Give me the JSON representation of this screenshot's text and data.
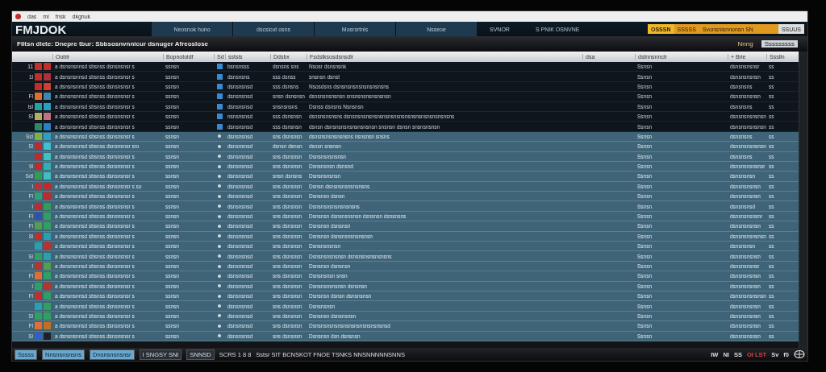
{
  "titlebar": {
    "menu": [
      "das",
      "mi",
      "fnsk",
      "dkgnuk"
    ]
  },
  "header": {
    "logo": "FMJDOK",
    "tabs": [
      {
        "label": "Neosnok huno",
        "selected": false
      },
      {
        "label": "dscsicut osns",
        "selected": false
      },
      {
        "label": "Mosrsrtnis",
        "selected": false
      },
      {
        "label": "Nsseoe",
        "selected": false
      }
    ],
    "items": [
      "SVNOR",
      "S PNIK OSNVNE"
    ],
    "alert": [
      "OSSSN",
      "SSSSS",
      "Svonsnisnnonsn SN",
      "SSUUS"
    ]
  },
  "filterbar": {
    "text": "Filtsn dlete: Dnepre tbur: Sbbsosnvnnicur dsnuger Afreoslose",
    "label": "Nnng",
    "value": "Sssssssss"
  },
  "table": {
    "columns": [
      "Ooblr",
      "Bopnotoldf",
      "Sd",
      "sstsis",
      "Ddsbx",
      "Fsdstksosdsnsdlr",
      "dsa",
      "dstnnsnnclr",
      "+ Brie",
      "Ssslln"
    ],
    "rows": [
      {
        "marker": "11",
        "tags": [
          {
            "color": "#c0302a"
          },
          {
            "color": "#c0302a"
          }
        ],
        "cells": [
          "a dsnsnsnnsd sbsnss dsnsnsnsr s",
          "ssnsn",
          "",
          "bsnsnsss",
          "dsnsns sns",
          "Nsosr dsnsnsnk",
          "",
          "Ssnsn",
          "dsnsnsnsnsr",
          "ss"
        ],
        "selected": false
      },
      {
        "marker": "1l",
        "tags": [
          {
            "color": "#c0302a"
          },
          {
            "color": "#b0303a"
          }
        ],
        "cells": [
          "a dsnsnsnnsd sbsnss dsnsnsnsr s",
          "ssnsn",
          "",
          "dsnsnsns",
          "sss dsnss",
          "snsnsn dsnst",
          "",
          "Ssnsn",
          "dsnsnsnsnsn",
          "ss"
        ],
        "selected": false
      },
      {
        "marker": "",
        "tags": [
          {
            "color": "#c0302a"
          },
          {
            "color": "#d04030"
          }
        ],
        "cells": [
          "a dsnsnsnnsd sbsnss dsnsnsnsr s",
          "ssnsn",
          "",
          "dsnsnsnsd",
          "sss dsnsns",
          "Nsosdsns dsnsnsnsnsnsnsnsnsns",
          "",
          "Ssnsn",
          "dsnsnsns",
          "ss"
        ],
        "selected": false
      },
      {
        "marker": "Fl",
        "tags": [
          {
            "color": "#e07030"
          },
          {
            "color": "#3a8ab0"
          }
        ],
        "cells": [
          "a dsnsnsnnsd sbsnss dsnsnsnsr s",
          "ssnsn",
          "",
          "dsnsnsnsd",
          "snsn dsnsnsn",
          "dsnsnsnsnsnsn snsnsnsnsnsnsnsn",
          "",
          "Ssnsn",
          "dsnsnsnsnsn",
          "ss"
        ],
        "selected": false
      },
      {
        "marker": "lsl",
        "tags": [
          {
            "color": "#2aa0a0"
          },
          {
            "color": "#2a9fc0"
          }
        ],
        "cells": [
          "a dsnsnsnnsd sbsnss dsnsnsnsr s",
          "ssnsn",
          "",
          "dsnsnsnsd",
          "snsnsnsns",
          "Dsnss dsnsns Nsnsnsn",
          "",
          "Ssnsn",
          "dsnsnsns",
          "ss"
        ],
        "selected": false
      },
      {
        "marker": "Sl",
        "tags": [
          {
            "color": "#b0b060"
          },
          {
            "color": "#c07080"
          }
        ],
        "cells": [
          "a dsnsnsnnsd sbsnss dsnsnsnsr s",
          "ssnsn",
          "",
          "nsnsnsnsd",
          "sss dsnsnsn",
          "dsnsnsnsnsns dsnsnsnsnsnsnsnsnsnsnsnsnsnsnsnsnsnsnsns",
          "",
          "Ssnsn",
          "dsnsnsnsnsnsn",
          "ss"
        ],
        "selected": false
      },
      {
        "marker": "",
        "tags": [
          {
            "color": "#2a8a6a"
          },
          {
            "color": "#2a80c0"
          }
        ],
        "cells": [
          "a dsnsnsnnsd sbsnss dsnsnsnsr s",
          "ssnsn",
          "",
          "dsnsnsnsd",
          "sss dsnsnsn",
          "dsnsn dsnsnsnsnsnsnsnsnsn snsnsn dsnsn snsnsnsnsn",
          "",
          "Ssnsn",
          "dsnsnsnsnsnsn",
          "ss"
        ],
        "selected": false
      },
      {
        "marker": "Ssl",
        "tags": [
          {
            "color": "#80b040"
          },
          {
            "color": "#30a0c0"
          }
        ],
        "cells": [
          "a dsnsnsnnsd sbsnss dsnsnsnsr s",
          "ssnsn",
          "",
          "dsnsnsnsd",
          "sns dsnsnsn",
          "dsnsnsnsnsnsnsns nsnsnsn snsns",
          "",
          "Ssnsn",
          "dsnsnsns",
          "ss"
        ],
        "selected": true
      },
      {
        "marker": "Sl",
        "tags": [
          {
            "color": "#c02a2a"
          },
          {
            "color": "#40c0d0"
          }
        ],
        "cells": [
          "a dsnsnsnnsd sbsnss dsnsnsnsr sro",
          "ssnsn",
          "",
          "dsnsnsnsd",
          "dsnsn dsnsn",
          "dsnsn snsnsn",
          "",
          "Ssnsn",
          "dsnsnsnsnsnsn",
          "ss"
        ],
        "selected": true
      },
      {
        "marker": "",
        "tags": [
          {
            "color": "#c02a2a"
          },
          {
            "color": "#40c0c0"
          }
        ],
        "cells": [
          "a dsnsnsnnsd sbsnss dsnsnsnsr s",
          "ssnsn",
          "",
          "dsnsnsnsd",
          "sns dsnsnsn",
          "Dsnsnsnsnsnsn",
          "",
          "Ssnsn",
          "dsnsnsns",
          "ss"
        ],
        "selected": true
      },
      {
        "marker": "9l",
        "tags": [
          {
            "color": "#c02a2a"
          },
          {
            "color": "#30b0b0"
          }
        ],
        "cells": [
          "a dsnsnsnnsd sbsnss dsnsnsnsr s",
          "ssnsn",
          "",
          "dsnsnsnsd",
          "sns dsnsnsn",
          "Dsnsnsnsn dsnsnd",
          "",
          "Ssnsn",
          "dsnsnsnsnsnsr",
          "ss"
        ],
        "selected": true
      },
      {
        "marker": "Sdl",
        "tags": [
          {
            "color": "#30a050"
          },
          {
            "color": "#40c0c0"
          }
        ],
        "cells": [
          "a dsnsnsnnsd sbsnss dsnsnsnsr s",
          "ssnsn",
          "",
          "dsnsnsnsd",
          "snsn dsnsns",
          "Dsnsnsnsnsn",
          "",
          "Ssnsn",
          "dsnsnsnsn",
          "ss"
        ],
        "selected": true
      },
      {
        "marker": "l",
        "tags": [
          {
            "color": "#c03030"
          },
          {
            "color": "#c02a2a"
          }
        ],
        "cells": [
          "a dsnsnsnnsd sbsnss dsnsnsnsr s so",
          "ssnsn",
          "",
          "dsnsnsnsd",
          "sns dsnsnsn",
          "Dsnsn dsnsnsnsnsnsnsns",
          "",
          "Ssnsn",
          "dsnsnsnsnsn",
          "ss"
        ],
        "selected": true
      },
      {
        "marker": "Fl",
        "tags": [
          {
            "color": "#30a070"
          },
          {
            "color": "#c02a2a"
          }
        ],
        "cells": [
          "a dsnsnsnnsd sbsnss dsnsnsnsr s",
          "ssnsn",
          "",
          "dsnsnsnsd",
          "sns dsnsnsn",
          "Dsnsnsn dsnsn",
          "",
          "Ssnsn",
          "dsnsnsnsnsn",
          "ss"
        ],
        "selected": true
      },
      {
        "marker": "l",
        "tags": [
          {
            "color": "#c02a2a"
          },
          {
            "color": "#30a050"
          }
        ],
        "cells": [
          "a dsnsnsnnsd sbsnss dsnsnsnsr s",
          "ssnsn",
          "",
          "dsnsnsnsd",
          "sns dsnsnsn",
          "Dsnsnsnsnsnsnsnsns",
          "",
          "Ssnsn",
          "dsnsnsnsd",
          "ss"
        ],
        "selected": true
      },
      {
        "marker": "Fl",
        "tags": [
          {
            "color": "#3050b0"
          },
          {
            "color": "#30a060"
          }
        ],
        "cells": [
          "a dsnsnsnnsd sbsnss dsnsnsnsr s",
          "ssnsn",
          "",
          "dsnsnsnsd",
          "sns dsnsnsn",
          "Dsnsnsn dsnsnsnsnsn dsnsnsn dsnsnsns",
          "",
          "Ssnsn",
          "dsnsnsnsnsnr",
          "ss"
        ],
        "selected": true
      },
      {
        "marker": "Fl",
        "tags": [
          {
            "color": "#50a050"
          },
          {
            "color": "#30a060"
          }
        ],
        "cells": [
          "a dsnsnsnnsd sbsnss dsnsnsnsr s",
          "ssnsn",
          "",
          "dsnsnsnsd",
          "sns dsnsnsn",
          "Dsnsnsn dsnsnsn",
          "",
          "Ssnsn",
          "dsnsnsnsnsn",
          "ss"
        ],
        "selected": true
      },
      {
        "marker": "8l",
        "tags": [
          {
            "color": "#c0302a"
          },
          {
            "color": "#2a9fb0"
          }
        ],
        "cells": [
          "a dsnsnsnnsd sbsnss dsnsnsnsr s",
          "ssnsn",
          "",
          "dsnsnsnsd",
          "sns dsnsnsn",
          "Dsnsnsn dsnsnsnsnsnsnsn",
          "",
          "Ssnsn",
          "dsnsnsnsnsnsn",
          "ss"
        ],
        "selected": true
      },
      {
        "marker": "",
        "tags": [
          {
            "color": "#2a9fb0"
          },
          {
            "color": "#c0302a"
          }
        ],
        "cells": [
          "a dsnsnsnnsd sbsnss dsnsnsnsr s",
          "ssnsn",
          "",
          "dsnsnsnsd",
          "sns dsnsnsn",
          "Dsnsnsnsnsn",
          "",
          "Ssnsn",
          "dsnsnsnsn",
          "ss"
        ],
        "selected": true
      },
      {
        "marker": "Sl",
        "tags": [
          {
            "color": "#30a060"
          },
          {
            "color": "#2a9fb0"
          }
        ],
        "cells": [
          "a dsnsnsnnsd sbsnss dsnsnsnsr s",
          "ssnsn",
          "",
          "dsnsnsnsd",
          "sns dsnsnsn",
          "Dsnsnsnsnsnsn dsnsnsnsnsnsnsns",
          "",
          "Ssnsn",
          "dsnsnsnsnsn",
          "ss"
        ],
        "selected": true
      },
      {
        "marker": "l",
        "tags": [
          {
            "color": "#c0302a"
          },
          {
            "color": "#50a050"
          }
        ],
        "cells": [
          "a dsnsnsnnsd sbsnss dsnsnsnsr s",
          "ssnsn",
          "",
          "dsnsnsnsd",
          "sns dsnsnsn",
          "Dsnsnsn dsnsnsn",
          "",
          "Ssnsn",
          "dsnsnsnsnsr",
          "ss"
        ],
        "selected": true
      },
      {
        "marker": "Fl",
        "tags": [
          {
            "color": "#e07030"
          },
          {
            "color": "#30a060"
          }
        ],
        "cells": [
          "a dsnsnsnnsd sbsnss dsnsnsnsr s",
          "ssnsn",
          "",
          "dsnsnsnsd",
          "sns dsnsnsn",
          "Dsnsnsnsn snsn",
          "",
          "Ssnsn",
          "dsnsnsnsnsn",
          "ss"
        ],
        "selected": true
      },
      {
        "marker": "l",
        "tags": [
          {
            "color": "#30a060"
          },
          {
            "color": "#c0302a"
          }
        ],
        "cells": [
          "a dsnsnsnnsd sbsnss dsnsnsnsr s",
          "ssnsn",
          "",
          "dsnsnsnsd",
          "sns dsnsnsn",
          "Dsnsnsnsnsnsn dsnsnsn",
          "",
          "Ssnsn",
          "dsnsnsnsnsn",
          "ss"
        ],
        "selected": true
      },
      {
        "marker": "Fl",
        "tags": [
          {
            "color": "#c0302a"
          },
          {
            "color": "#30a060"
          }
        ],
        "cells": [
          "a dsnsnsnnsd sbsnss dsnsnsnsr s",
          "ssnsn",
          "",
          "dsnsnsnsd",
          "sns dsnsnsn",
          "Dsnsnsn dsnsn dsnsnsnsn",
          "",
          "Ssnsn",
          "dsnsnsnsnsnsn",
          "ss"
        ],
        "selected": true
      },
      {
        "marker": "",
        "tags": [
          {
            "color": "#2a9fb0"
          },
          {
            "color": "#30a060"
          }
        ],
        "cells": [
          "a dsnsnsnnsd sbsnss dsnsnsnsr s",
          "ssnsn",
          "",
          "dsnsnsnsd",
          "sns dsnsnsn",
          "Dsnsnsnsn",
          "",
          "Ssnsn",
          "dsnsnsnsnsn",
          "ss"
        ],
        "selected": true
      },
      {
        "marker": "Sl",
        "tags": [
          {
            "color": "#30a060"
          },
          {
            "color": "#30a060"
          }
        ],
        "cells": [
          "a dsnsnsnnsd sbsnss dsnsnsnsr s",
          "ssnsn",
          "",
          "dsnsnsnsd",
          "sns dsnsnsn",
          "Dsnsnsn dsnsnsnsn",
          "",
          "Ssnsn",
          "dsnsnsnsnsn",
          "ss"
        ],
        "selected": true
      },
      {
        "marker": "Fl",
        "tags": [
          {
            "color": "#e07030"
          },
          {
            "color": "#c07020"
          }
        ],
        "cells": [
          "a dsnsnsnnsd sbsnss dsnsnsnsr s",
          "ssnsn",
          "",
          "dsnsnsnsd",
          "sns dsnsnsn",
          "Dsnsnsnsnsnsnsnsnsnsnsnsnsnsd",
          "",
          "Ssnsn",
          "dsnsnsnsnsn",
          "ss"
        ],
        "selected": true
      },
      {
        "marker": "Sl",
        "tags": [
          {
            "color": "#3060d0"
          },
          {
            "color": "#20202a"
          }
        ],
        "cells": [
          "a dsnsnsnnsd sbsnss dsnsnsnsr s",
          "ssnsn",
          "",
          "dsnsnsnsd",
          "sns dsnsnsn",
          "Dsnsnsn dsn dsnsnsn",
          "",
          "Ssnsn",
          "dsnsnsnsnsn",
          "ss"
        ],
        "selected": true
      }
    ]
  },
  "statusbar": {
    "left": [
      {
        "label": "Sssss",
        "selected": true
      },
      {
        "label": "Nnsnsnsnsns",
        "selected": true
      },
      {
        "label": "Dnsnsnsnsnsr",
        "selected": true
      },
      {
        "label": "I SNGSY SNI",
        "selected": false
      },
      {
        "label": "SNNSD",
        "selected": false
      }
    ],
    "texts": [
      "SCRS 1  8 8",
      "Sstsr SIT BCNSKOT FNOE TSNKS NNSNNNNNSNNS"
    ],
    "right": [
      {
        "label": "IW",
        "alert": false
      },
      {
        "label": "NI",
        "alert": false
      },
      {
        "label": "SS",
        "alert": false
      },
      {
        "label": "OI LST",
        "alert": true
      },
      {
        "label": "Sv",
        "alert": false
      },
      {
        "label": "f0",
        "alert": false
      }
    ]
  }
}
